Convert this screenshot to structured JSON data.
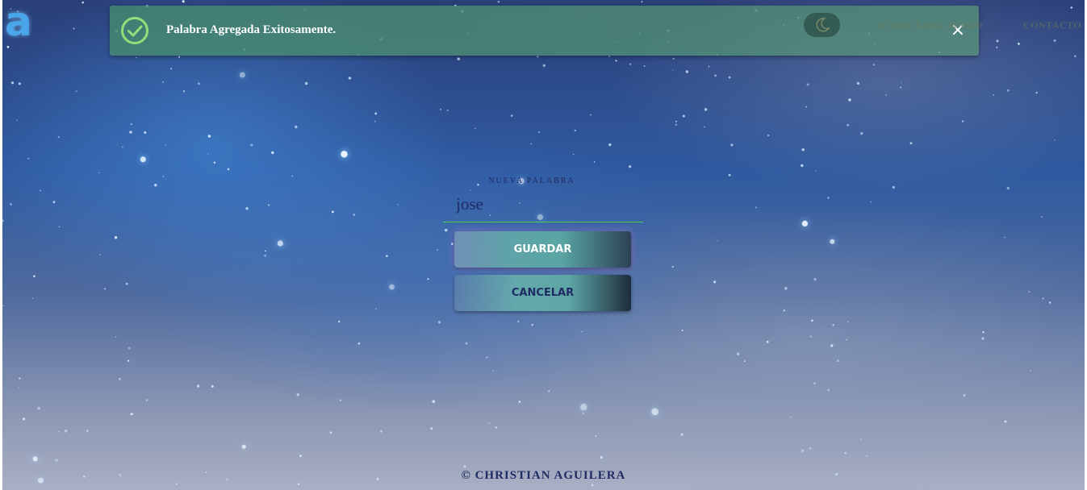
{
  "header": {
    "logo_letter": "a",
    "nav": [
      {
        "label": "ACERCA DEL JUEGO"
      },
      {
        "label": "CONTACTO"
      }
    ],
    "theme_toggle_icon": "moon-icon"
  },
  "toast": {
    "icon": "check-circle-icon",
    "message": "Palabra Agregada Exitosamente.",
    "close_icon": "close-icon",
    "close_symbol": "×",
    "color": "#5a9a7a"
  },
  "form": {
    "label": "NUEVA PALABRA",
    "word_value": "jose",
    "save_label": "GUARDAR",
    "cancel_label": "CANCELAR",
    "accent_color": "#4ccb52"
  },
  "footer": {
    "text": "© CHRISTIAN AGUILERA"
  }
}
